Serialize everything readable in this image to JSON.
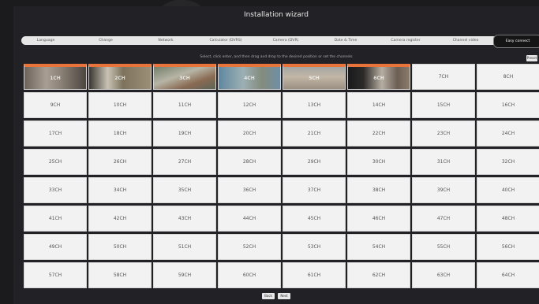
{
  "window": {
    "title": "Installation wizard"
  },
  "steps": [
    {
      "label": "Language"
    },
    {
      "label": "Change"
    },
    {
      "label": "Network"
    },
    {
      "label": "Calculator (DVRS)"
    },
    {
      "label": "Camera (DVR)"
    },
    {
      "label": "Date & Time"
    },
    {
      "label": "Camera register"
    },
    {
      "label": "Channel video"
    },
    {
      "label": "Easy connect"
    }
  ],
  "hint": "Select, click enter, and then drag and drop to the desired position or set the channels",
  "preset_label": "Preset",
  "channels": [
    "1CH",
    "2CH",
    "3CH",
    "4CH",
    "5CH",
    "6CH",
    "7CH",
    "8CH",
    "9CH",
    "10CH",
    "11CH",
    "12CH",
    "13CH",
    "14CH",
    "15CH",
    "16CH",
    "17CH",
    "18CH",
    "19CH",
    "20CH",
    "21CH",
    "22CH",
    "23CH",
    "24CH",
    "25CH",
    "26CH",
    "27CH",
    "28CH",
    "29CH",
    "30CH",
    "31CH",
    "32CH",
    "33CH",
    "34CH",
    "35CH",
    "36CH",
    "37CH",
    "38CH",
    "39CH",
    "40CH",
    "41CH",
    "42CH",
    "43CH",
    "44CH",
    "45CH",
    "46CH",
    "47CH",
    "48CH",
    "49CH",
    "50CH",
    "51CH",
    "52CH",
    "53CH",
    "54CH",
    "55CH",
    "56CH",
    "57CH",
    "58CH",
    "59CH",
    "60CH",
    "61CH",
    "62CH",
    "63CH",
    "64CH"
  ],
  "live_channels": 6,
  "footer": {
    "back_label": "Back",
    "next_label": "Next"
  },
  "colors": {
    "accent": "#e8743b",
    "background": "#1b1b1d",
    "cell": "#f2f2f2"
  }
}
